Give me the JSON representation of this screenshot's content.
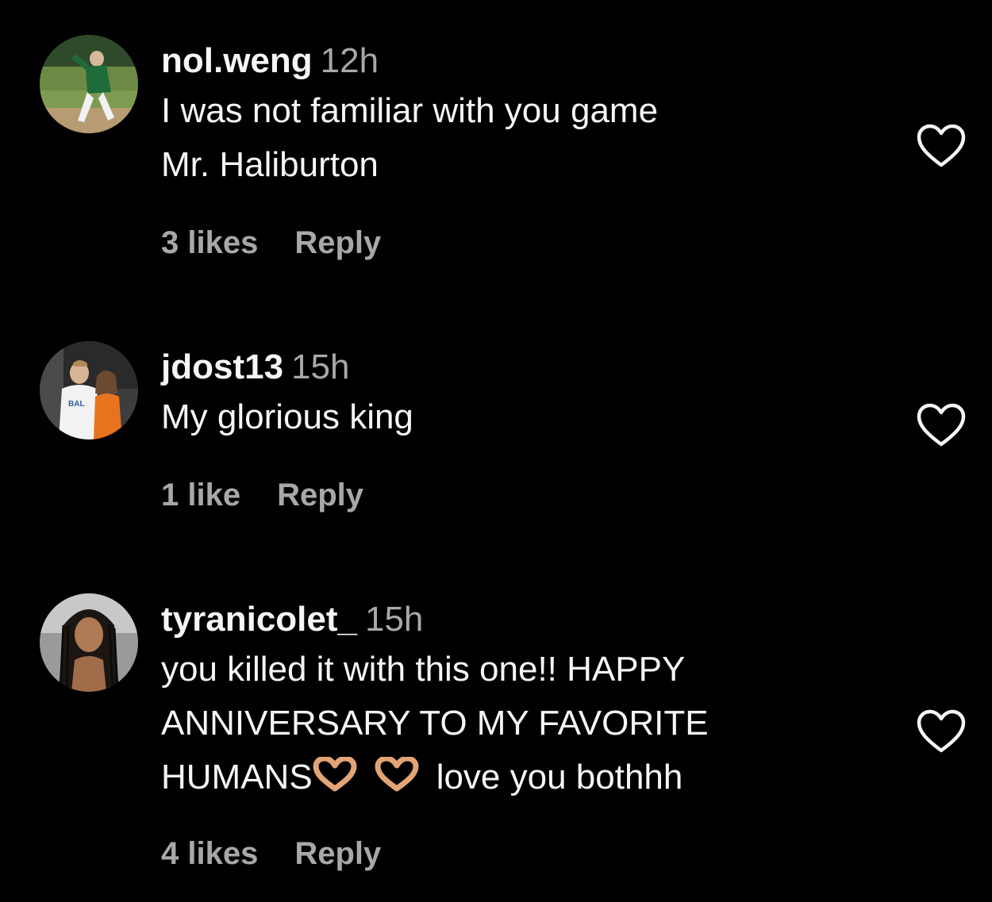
{
  "comments": [
    {
      "username": "nol.weng",
      "time": "12h",
      "text_lines": [
        "I was not familiar with you game",
        "Mr. Haliburton"
      ],
      "likes": "3 likes",
      "reply": "Reply",
      "avatar": "avatar-baseball-pitcher",
      "like_icon": "heart-outline-icon"
    },
    {
      "username": "jdost13",
      "time": "15h",
      "text_lines": [
        "My glorious king"
      ],
      "likes": "1 like",
      "reply": "Reply",
      "avatar": "avatar-couple-photo",
      "like_icon": "heart-outline-icon"
    },
    {
      "username": "tyranicolet_",
      "time": "15h",
      "text_lines": [
        "you killed it with this one!! HAPPY",
        "ANNIVERSARY TO MY FAVORITE",
        "HUMANS",
        "love you bothhh"
      ],
      "emoji": "heart-hands-emoji",
      "likes": "4 likes",
      "reply": "Reply",
      "avatar": "avatar-woman-braids",
      "like_icon": "heart-outline-icon"
    }
  ],
  "colors": {
    "background": "#000000",
    "primary_text": "#f5f5f5",
    "secondary_text": "#a8a8a8"
  }
}
